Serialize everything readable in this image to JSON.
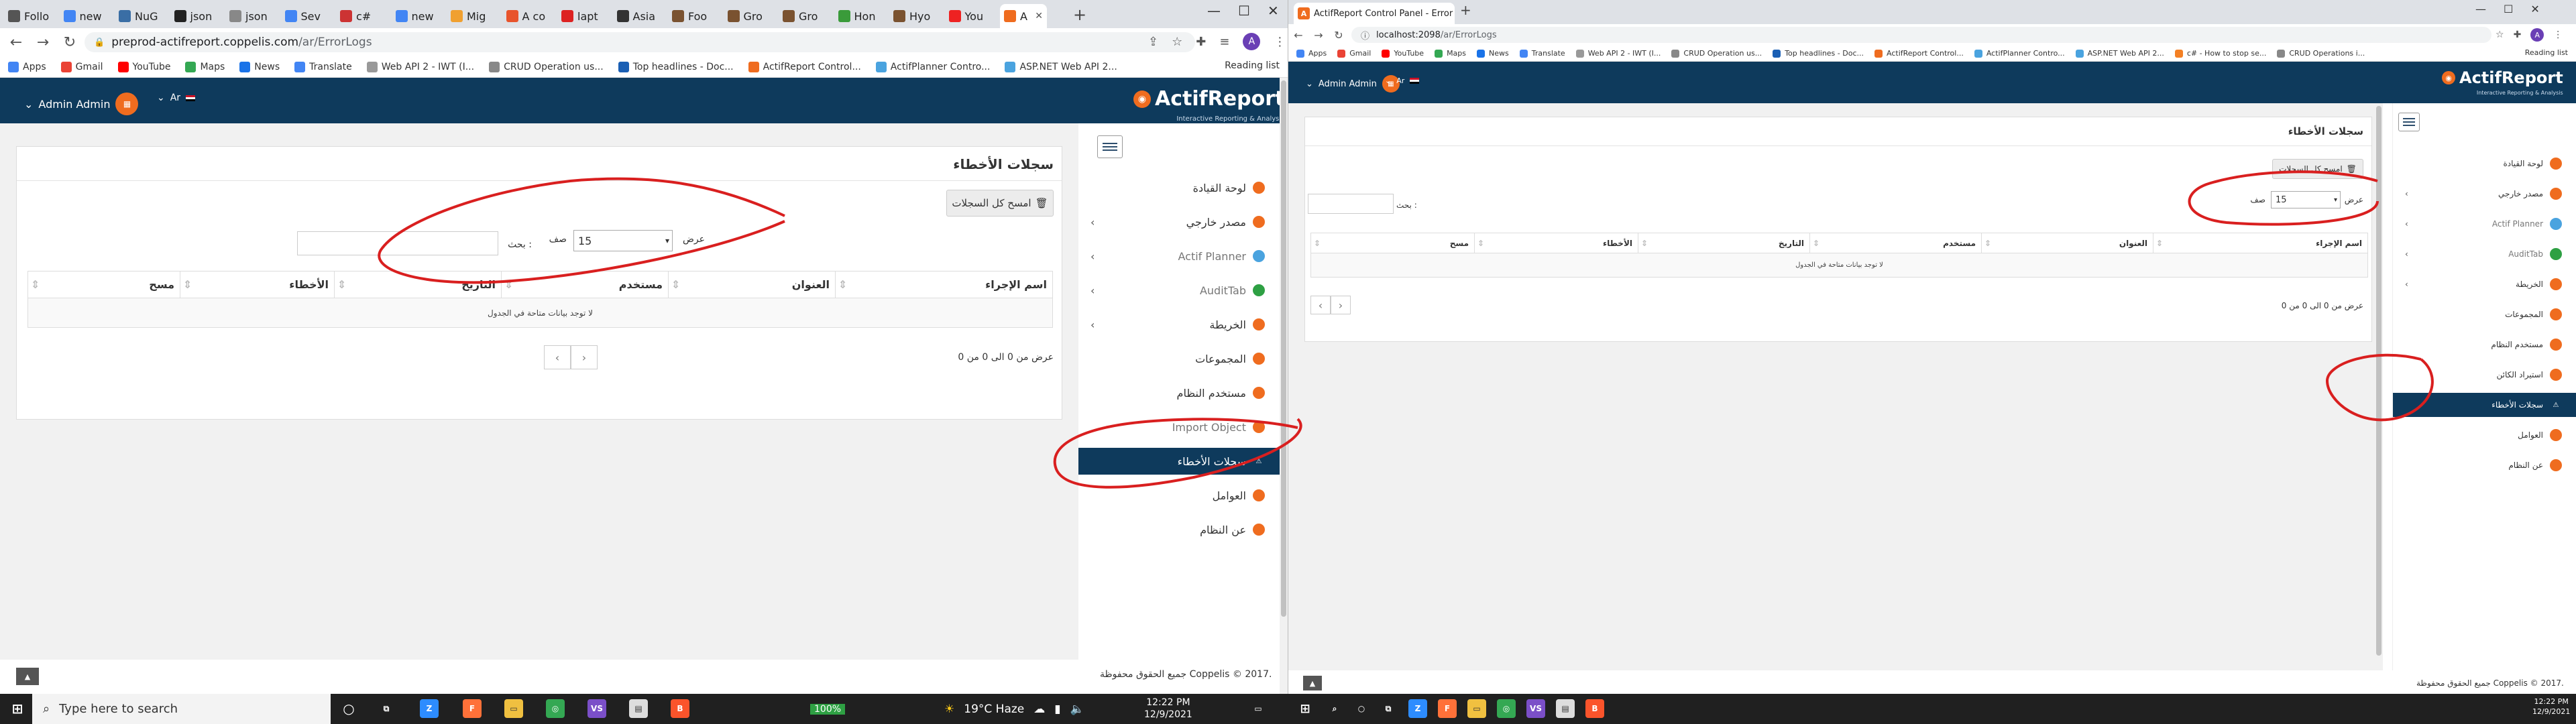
{
  "left": {
    "tabs": [
      "Follo",
      "new",
      "NuG",
      "json",
      "json",
      "Sev",
      "c#",
      "new",
      "Mig",
      "A co",
      "lapt",
      "Asia",
      "Foo",
      "Gro",
      "Gro",
      "Hon",
      "Hyo",
      "You",
      "A"
    ],
    "url": {
      "host": "preprod-actifreport.coppelis.com",
      "path": "/ar/ErrorLogs"
    },
    "bookmarks": [
      "Apps",
      "Gmail",
      "YouTube",
      "Maps",
      "News",
      "Translate",
      "Web API 2 - IWT (I...",
      "CRUD Operation us...",
      "Top headlines - Doc...",
      "ActifReport Control...",
      "ActifPlanner Contro...",
      "ASP.NET Web API 2..."
    ],
    "reading_list": "Reading list",
    "header": {
      "user": "Admin Admin",
      "lang": "Ar",
      "logo": "ActifReport",
      "logo_sub": "Interactive Reporting & Analysis"
    },
    "panel": {
      "title": "سجلات الأخطاء",
      "clear_button": "امسح كل السجلات",
      "show_label": "عرض",
      "page_size": "15",
      "rows_label": "صف",
      "search_label": "بحث :",
      "columns": [
        "اسم الإجراء",
        "العنوان",
        "مستخدم",
        "التاريخ",
        "الأخطاء",
        "مسح"
      ],
      "empty": "لا توجد بيانات متاحة في الجدول",
      "info": "عرض من 0 الى 0 من 0 ",
      "prev": "‹",
      "next": "›"
    },
    "sidebar": [
      "لوحة القيادة",
      "مصدر خارجي",
      "Actif Planner",
      "AuditTab",
      "الخريطة",
      "المجموعات",
      "مستخدم النظام",
      "Import Object",
      "سجلات الأخطاء",
      "العوامل",
      "عن النظام"
    ],
    "footer": "جميع الحقوق محفوظة Coppelis © 2017."
  },
  "right": {
    "tab": "ActifReport Control Panel - Error",
    "url": {
      "host": "localhost:2098",
      "path": "/ar/ErrorLogs"
    },
    "bookmarks": [
      "Apps",
      "Gmail",
      "YouTube",
      "Maps",
      "News",
      "Translate",
      "Web API 2 - IWT (I...",
      "CRUD Operation us...",
      "Top headlines - Doc...",
      "ActifReport Control...",
      "ActifPlanner Contro...",
      "ASP.NET Web API 2...",
      "c# - How to stop se...",
      "CRUD Operations i..."
    ],
    "reading_list": "Reading list",
    "header": {
      "user": "Admin Admin",
      "lang": "Ar",
      "logo": "ActifReport",
      "logo_sub": "Interactive Reporting & Analysis"
    },
    "panel": {
      "title": "سجلات الأخطاء",
      "clear_button": "امسح كل السجلات",
      "show_label": "عرض",
      "page_size": "15",
      "rows_label": "صف",
      "search_label": "بحث :",
      "columns": [
        "اسم الإجراء",
        "العنوان",
        "مستخدم",
        "التاريخ",
        "الأخطاء",
        "مسح"
      ],
      "empty": "لا توجد بيانات متاحة في الجدول",
      "info": "عرض من 0 الى 0 من 0 ",
      "prev": "‹",
      "next": "›"
    },
    "sidebar": [
      "لوحة القيادة",
      "مصدر خارجي",
      "Actif Planner",
      "AuditTab",
      "الخريطة",
      "المجموعات",
      "مستخدم النظام",
      "استيراد الكائن",
      "سجلات الأخطاء",
      "العوامل",
      "عن النظام"
    ],
    "footer": "جميع الحقوق محفوظة Coppelis © 2017."
  },
  "taskbar": {
    "search": "Type here to search",
    "battery": "100%",
    "weather": "19°C  Haze",
    "time": "12:22 PM",
    "date": "12/9/2021",
    "time_right": "12:22 PM",
    "date_right": "12/9/2021"
  },
  "colors": {
    "navy": "#0e3a5c",
    "orange": "#ef6c1f",
    "annotation": "#d91f1f"
  }
}
